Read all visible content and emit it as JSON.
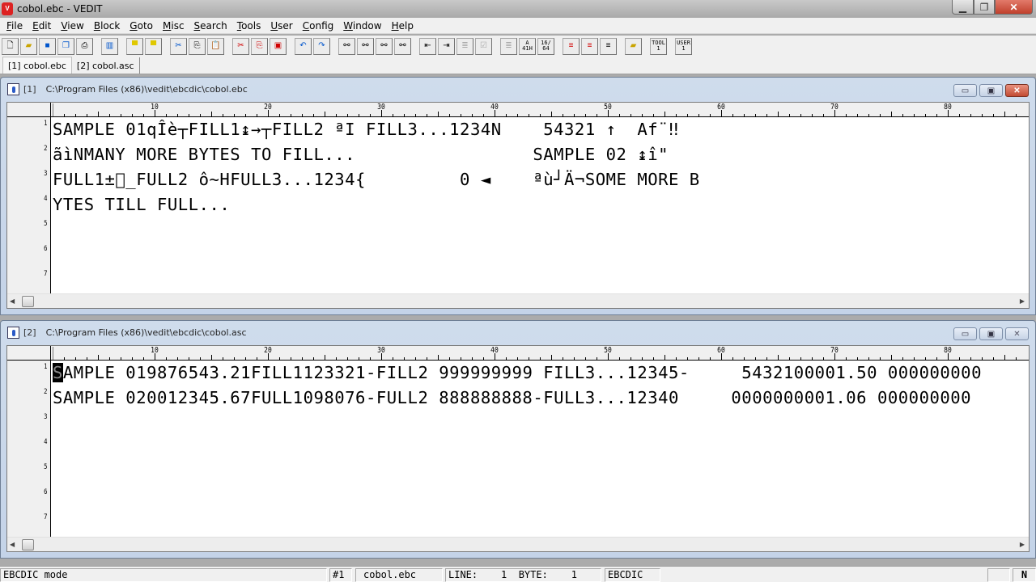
{
  "window": {
    "title": "cobol.ebc - VEDIT",
    "app_icon": "vedit-knife-icon",
    "controls": [
      "minimize",
      "restore",
      "close"
    ]
  },
  "menu": {
    "items": [
      {
        "label": "File",
        "accel": "F"
      },
      {
        "label": "Edit",
        "accel": "E"
      },
      {
        "label": "View",
        "accel": "V"
      },
      {
        "label": "Block",
        "accel": "B"
      },
      {
        "label": "Goto",
        "accel": "G"
      },
      {
        "label": "Misc",
        "accel": "M"
      },
      {
        "label": "Search",
        "accel": "S"
      },
      {
        "label": "Tools",
        "accel": "T"
      },
      {
        "label": "User",
        "accel": "U"
      },
      {
        "label": "Config",
        "accel": "C"
      },
      {
        "label": "Window",
        "accel": "W"
      },
      {
        "label": "Help",
        "accel": "H"
      }
    ]
  },
  "toolbar": {
    "buttons": [
      {
        "name": "new-file",
        "glyph": "🗋"
      },
      {
        "name": "open-file",
        "glyph": "📂"
      },
      {
        "name": "save-file",
        "glyph": "💾"
      },
      {
        "name": "save-all",
        "glyph": "🗐"
      },
      {
        "name": "print",
        "glyph": "🖶"
      },
      {
        "name": "split-window",
        "glyph": "▥"
      },
      {
        "name": "prev-buffer",
        "glyph": "⇤"
      },
      {
        "name": "next-buffer",
        "glyph": "⇥"
      },
      {
        "name": "cut",
        "glyph": "✂"
      },
      {
        "name": "copy",
        "glyph": "⎘"
      },
      {
        "name": "paste",
        "glyph": "📋"
      },
      {
        "name": "cut-scratch",
        "glyph": "✂ˢ"
      },
      {
        "name": "copy-scratch",
        "glyph": "⎘ˢ"
      },
      {
        "name": "paste-scratch",
        "glyph": "📋ˢ"
      },
      {
        "name": "undo",
        "glyph": "↶"
      },
      {
        "name": "redo",
        "glyph": "↷"
      },
      {
        "name": "find",
        "glyph": "🔭"
      },
      {
        "name": "find-replace",
        "glyph": "🔭R"
      },
      {
        "name": "find-next",
        "glyph": "🔭→"
      },
      {
        "name": "find-prev",
        "glyph": "←🔭"
      },
      {
        "name": "outdent",
        "glyph": "⇤≡"
      },
      {
        "name": "indent",
        "glyph": "⇥≡"
      },
      {
        "name": "format-paragraph",
        "glyph": "≣"
      },
      {
        "name": "spell-check",
        "glyph": "☑"
      },
      {
        "name": "justify",
        "glyph": "≣"
      },
      {
        "name": "char-code",
        "glyph": "A 41H"
      },
      {
        "name": "hex-convert",
        "glyph": "16/64"
      },
      {
        "name": "mark-lines-red",
        "glyph": "≡"
      },
      {
        "name": "mark-lines-alt",
        "glyph": "≡"
      },
      {
        "name": "lines",
        "glyph": "≡"
      },
      {
        "name": "file-search",
        "glyph": "📁"
      },
      {
        "name": "tool-1",
        "glyph": "TOOL 1"
      },
      {
        "name": "user-1",
        "glyph": "USER 1"
      }
    ]
  },
  "tabs": [
    {
      "label": "[1] cobol.ebc",
      "active": true
    },
    {
      "label": "[2] cobol.asc",
      "active": false
    }
  ],
  "windows": [
    {
      "number": "[1]",
      "path": "C:\\Program Files (x86)\\vedit\\ebcdic\\cobol.ebc",
      "ruler_labels": [
        "10",
        "20",
        "30",
        "40",
        "50",
        "60",
        "70",
        "80"
      ],
      "line_numbers": [
        "1",
        "2",
        "3",
        "4",
        "5",
        "6",
        "7"
      ],
      "lines": [
        "SAMPLE 01qÎè┬FILL1↨→┬FILL2 ªI FILL3...1234N    54321 ↑  Af¨‼",
        "ãìNMANY MORE BYTES TO FILL...                 SAMPLE 02 ↨î\"",
        "FULL1±\u0000_FULL2 ô~HFULL3...1234{         0 ◄    ªù┘Ä¬SOME MORE B",
        "YTES TILL FULL..."
      ]
    },
    {
      "number": "[2]",
      "path": "C:\\Program Files (x86)\\vedit\\ebcdic\\cobol.asc",
      "ruler_labels": [
        "10",
        "20",
        "30",
        "40",
        "50",
        "60",
        "70",
        "80"
      ],
      "line_numbers": [
        "1",
        "2",
        "3",
        "4",
        "5",
        "6",
        "7"
      ],
      "cursor_char": "S",
      "lines": [
        "AMPLE 019876543.21FILL1123321-FILL2 999999999 FILL3...12345-     5432100001.50 000000000",
        "SAMPLE 020012345.67FULL1098076-FULL2 888888888-FULL3...12340     0000000001.06 000000000"
      ]
    }
  ],
  "statusbar": {
    "mode": "EBCDIC mode",
    "window_num": "#1",
    "filename": "cobol.ebc",
    "position": "LINE:    1  BYTE:    1",
    "encoding": "EBCDIC",
    "blank": "",
    "insert_mode": "N"
  }
}
